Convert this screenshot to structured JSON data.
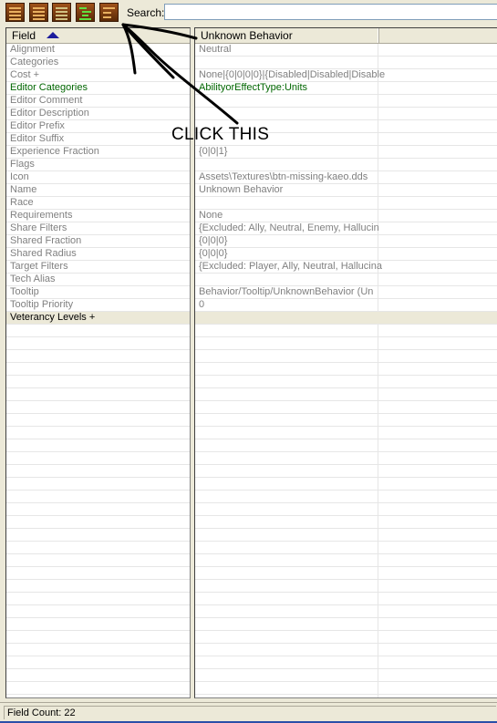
{
  "toolbar": {
    "buttons": [
      {
        "name": "view-mode-1",
        "icon": "table-view-icon"
      },
      {
        "name": "view-mode-2",
        "icon": "table-view-alt-icon"
      },
      {
        "name": "view-mode-3",
        "icon": "raw-data-icon"
      },
      {
        "name": "view-mode-4",
        "icon": "tree-view-icon"
      },
      {
        "name": "view-mode-5",
        "icon": "sort-list-icon"
      }
    ],
    "search_label": "Search:",
    "search_value": ""
  },
  "left_pane": {
    "column_header": "Field",
    "sort": "ascending"
  },
  "right_pane": {
    "column_header": "Unknown Behavior"
  },
  "rows": [
    {
      "field": "Alignment",
      "value": "Neutral",
      "style": "default"
    },
    {
      "field": "Categories",
      "value": "",
      "style": "default"
    },
    {
      "field": "Cost +",
      "value": "None|{0|0|0|0}|{Disabled|Disabled|Disable",
      "style": "default"
    },
    {
      "field": "Editor Categories",
      "value": "AbilityorEffectType:Units",
      "style": "green"
    },
    {
      "field": "Editor Comment",
      "value": "",
      "style": "default"
    },
    {
      "field": "Editor Description",
      "value": "",
      "style": "default"
    },
    {
      "field": "Editor Prefix",
      "value": "",
      "style": "default"
    },
    {
      "field": "Editor Suffix",
      "value": "",
      "style": "default"
    },
    {
      "field": "Experience Fraction",
      "value": "{0|0|1}",
      "style": "default"
    },
    {
      "field": "Flags",
      "value": "",
      "style": "default"
    },
    {
      "field": "Icon",
      "value": "Assets\\Textures\\btn-missing-kaeo.dds",
      "style": "default"
    },
    {
      "field": "Name",
      "value": "Unknown Behavior",
      "style": "default"
    },
    {
      "field": "Race",
      "value": "",
      "style": "default"
    },
    {
      "field": "Requirements",
      "value": "None",
      "style": "default"
    },
    {
      "field": "Share Filters",
      "value": "{Excluded: Ally, Neutral, Enemy, Hallucin",
      "style": "default"
    },
    {
      "field": "Shared Fraction",
      "value": "{0|0|0}",
      "style": "default"
    },
    {
      "field": "Shared Radius",
      "value": "{0|0|0}",
      "style": "default"
    },
    {
      "field": "Target Filters",
      "value": "{Excluded: Player, Ally, Neutral, Hallucina",
      "style": "default"
    },
    {
      "field": "Tech Alias",
      "value": "",
      "style": "default"
    },
    {
      "field": "Tooltip",
      "value": "Behavior/Tooltip/UnknownBehavior (Un",
      "style": "default"
    },
    {
      "field": "Tooltip Priority",
      "value": "0",
      "style": "default"
    },
    {
      "field": "Veterancy Levels +",
      "value": "",
      "style": "selected"
    }
  ],
  "status": {
    "text": "Field Count: 22"
  },
  "annotation": {
    "text": "CLICK THIS",
    "color": "#000000"
  }
}
